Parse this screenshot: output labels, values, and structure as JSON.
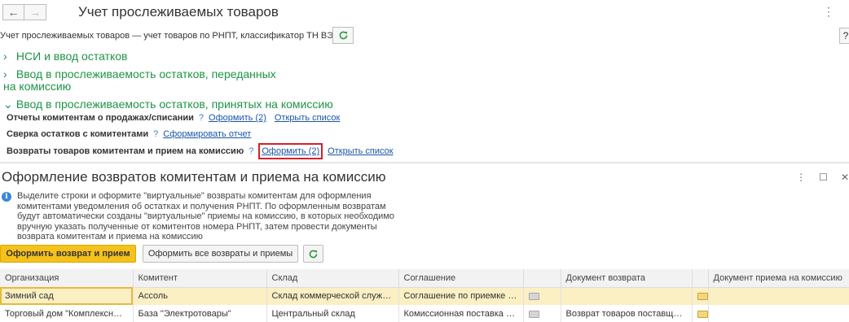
{
  "window": {
    "title": "Учет прослеживаемых товаров",
    "description": "Учет прослеживаемых товаров — учет товаров по РНПТ, классификатор ТН ВЭД.",
    "help": "?"
  },
  "groups": [
    {
      "label": "НСИ и ввод остатков"
    },
    {
      "label": "Ввод в прослеживаемость остатков, переданных на комиссию"
    },
    {
      "label": "Ввод в прослеживаемость остатков, принятых на комиссию"
    }
  ],
  "rows": [
    {
      "label": "Отчеты комитентам о продажах/списании",
      "q": "?",
      "link1": "Оформить (2)",
      "link2": "Открыть список"
    },
    {
      "label": "Сверка остатков с комитентами",
      "q": "?",
      "link1": "Сформировать отчет"
    },
    {
      "label": "Возвраты товаров комитентам и прием на комиссию",
      "q": "?",
      "link1": "Оформить (2)",
      "link2": "Открыть список"
    }
  ],
  "subform": {
    "title": "Оформление возвратов комитентам и приема на комиссию",
    "info": "Выделите строки и оформите \"виртуальные\" возвраты комитентам для оформления комитентами уведомления об остатках и получения РНПТ. По оформленным возвратам будут автоматически созданы \"виртуальные\" приемы на комиссию, в которых необходимо вручную указать полученные от комитентов номера РНПТ, затем провести документы возврата комитентам и приема на комиссию",
    "btn_primary": "Оформить возврат и прием",
    "btn_all": "Оформить все возвраты и приемы"
  },
  "table": {
    "columns": [
      "Организация",
      "Комитент",
      "Склад",
      "Соглашение",
      "",
      "Документ возврата",
      "",
      "Документ приема на комиссию"
    ],
    "rows": [
      {
        "org": "Зимний сад",
        "committent": "Ассоль",
        "warehouse": "Склад коммерческой службы",
        "agreement": "Соглашение по приемке н...",
        "return_doc": "",
        "accept_doc": ""
      },
      {
        "org": "Торговый дом \"Комплексный\"",
        "committent": "База \"Электротовары\"",
        "warehouse": "Центральный склад",
        "agreement": "Комиссионная поставка б...",
        "return_doc": "Возврат товаров поставщик...",
        "accept_doc": ""
      }
    ]
  },
  "colors": {
    "group_green": "#1e9447",
    "link_blue": "#1a56a8",
    "primary_yellow": "#f5c11b",
    "highlight_red": "#d4202b",
    "selection": "#fbefc4"
  }
}
